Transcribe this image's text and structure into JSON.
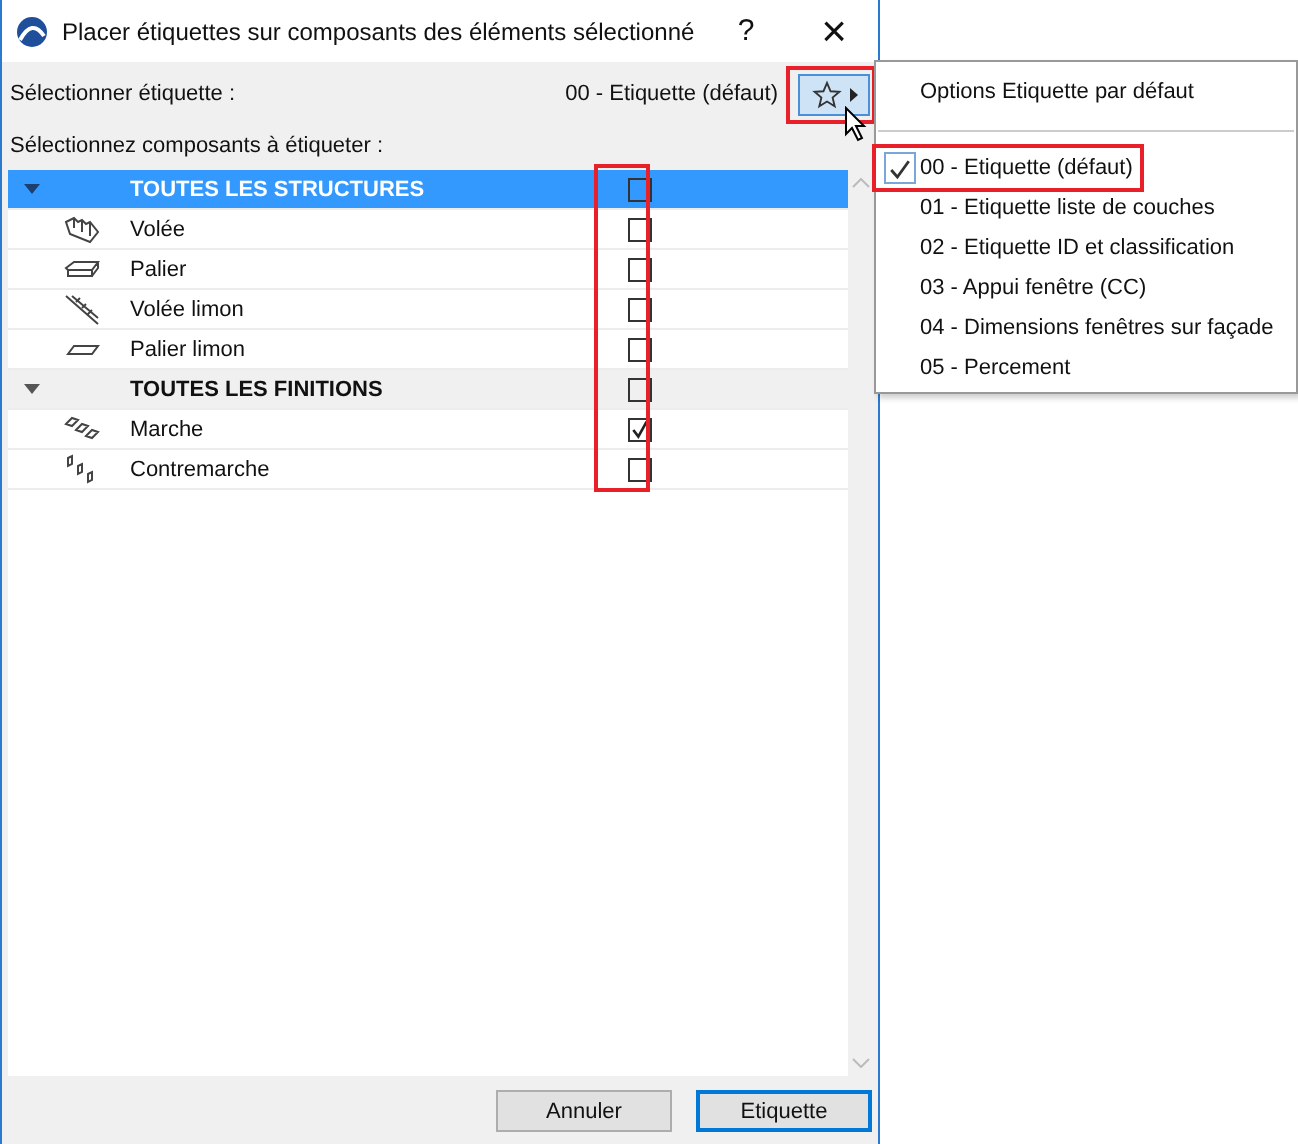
{
  "window": {
    "title": "Placer étiquettes sur composants des éléments sélectionné",
    "help": "?",
    "close": "×"
  },
  "label_select": {
    "label": "Sélectionner étiquette :",
    "value": "00 - Etiquette (défaut)"
  },
  "components_label": "Sélectionnez composants à étiqueter :",
  "groups": [
    {
      "name": "TOUTES LES STRUCTURES",
      "selected": true,
      "expanded": true,
      "checked": false,
      "children": [
        {
          "name": "Volée",
          "kind": "flight",
          "checked": false
        },
        {
          "name": "Palier",
          "kind": "landing",
          "checked": false
        },
        {
          "name": "Volée limon",
          "kind": "stringer",
          "checked": false
        },
        {
          "name": "Palier limon",
          "kind": "plate",
          "checked": false
        }
      ]
    },
    {
      "name": "TOUTES LES FINITIONS",
      "selected": false,
      "expanded": true,
      "checked": false,
      "children": [
        {
          "name": "Marche",
          "kind": "tread",
          "checked": true
        },
        {
          "name": "Contremarche",
          "kind": "riser",
          "checked": false
        }
      ]
    }
  ],
  "buttons": [
    {
      "label": "Annuler",
      "default": false
    },
    {
      "label": "Etiquette",
      "default": true
    }
  ],
  "menu": {
    "header": "Options Etiquette par défaut",
    "items": [
      {
        "label": "00 - Etiquette (défaut)",
        "selected": true
      },
      {
        "label": "01 - Etiquette liste de couches",
        "selected": false
      },
      {
        "label": "02 - Etiquette ID et classification",
        "selected": false
      },
      {
        "label": "03 - Appui fenêtre (CC)",
        "selected": false
      },
      {
        "label": "04 - Dimensions fenêtres sur façade",
        "selected": false
      },
      {
        "label": "05 - Percement",
        "selected": false
      }
    ]
  }
}
